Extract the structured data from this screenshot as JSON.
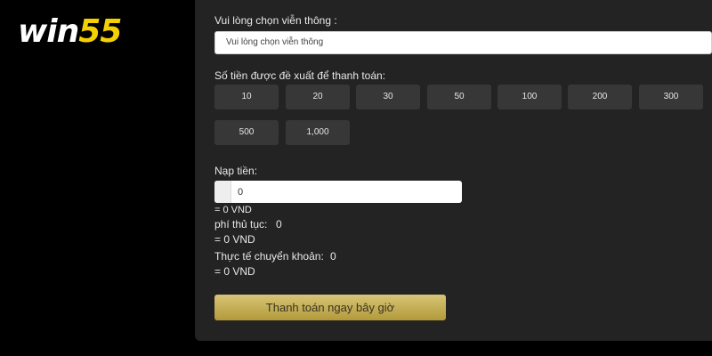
{
  "brand": {
    "logo_part1": "win",
    "logo_part2": "55"
  },
  "form": {
    "carrier_label": "Vui lòng chọn viễn thông :",
    "carrier_select_value": "Vui lòng chọn viễn thông",
    "suggested_label": "Số tiền được đề xuất để thanh toán:",
    "suggested_amounts": [
      "10",
      "20",
      "30",
      "50",
      "100",
      "200",
      "300",
      "500",
      "1,000"
    ],
    "deposit_label": "Nạp tiền:",
    "deposit_value": "0",
    "deposit_vnd": "= 0 VND",
    "fee_label": "phí thủ tục:",
    "fee_value": "0",
    "fee_vnd": "= 0 VND",
    "actual_label": "Thực tế chuyển khoản:",
    "actual_value": "0",
    "actual_vnd": "= 0 VND",
    "pay_button": "Thanh toán ngay bây giờ"
  },
  "colors": {
    "logo_accent": "#f5d000",
    "panel_bg": "#232323",
    "chip_bg": "#373737",
    "button_gold": "#c8b158"
  }
}
